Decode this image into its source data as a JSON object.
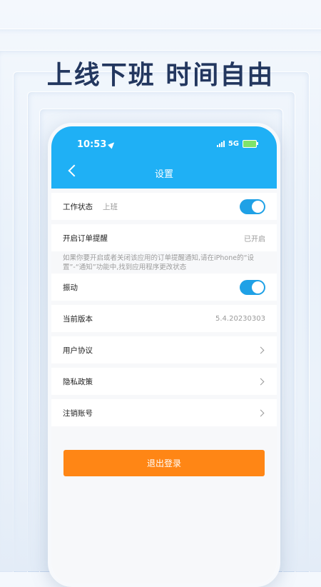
{
  "headline": "上线下班 时间自由",
  "status_bar": {
    "time": "10:53",
    "network": "5G"
  },
  "nav": {
    "title": "设置"
  },
  "settings": {
    "work_status": {
      "label": "工作状态",
      "value": "上班",
      "toggle_on": true
    },
    "order_reminder": {
      "label": "开启订单提醒",
      "value": "已开启",
      "note": "如果你要开启或者关闭该应用的订单提醒通知,请在iPhone的“设置”-“通知”功能中,找到应用程序更改状态"
    },
    "vibration": {
      "label": "振动",
      "toggle_on": true
    },
    "version": {
      "label": "当前版本",
      "value": "5.4.20230303"
    },
    "user_agreement": {
      "label": "用户协议"
    },
    "privacy_policy": {
      "label": "隐私政策"
    },
    "delete_account": {
      "label": "注销账号"
    }
  },
  "logout_button": "退出登录",
  "colors": {
    "header_blue": "#1fb0f5",
    "toggle_blue": "#1fa1e6",
    "logout_orange": "#ff8615",
    "headline_navy": "#23375f"
  }
}
